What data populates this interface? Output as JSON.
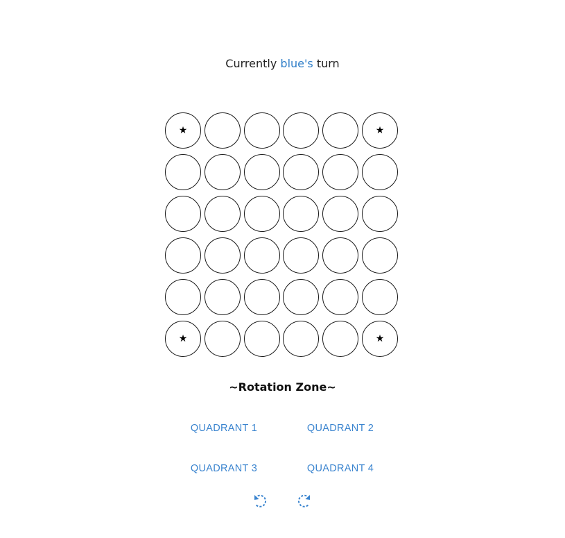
{
  "turn": {
    "prefix": "Currently",
    "player": "blue's",
    "suffix": "turn"
  },
  "board": {
    "rows": 6,
    "cols": 6,
    "stars": [
      [
        0,
        0
      ],
      [
        0,
        5
      ],
      [
        5,
        0
      ],
      [
        5,
        5
      ]
    ],
    "star_glyph": "★"
  },
  "rotation_zone": {
    "title": "~Rotation Zone~",
    "quadrants": [
      "QUADRANT 1",
      "QUADRANT 2",
      "QUADRANT 3",
      "QUADRANT 4"
    ],
    "rotate_left_icon": "rotate-counterclockwise-icon",
    "rotate_right_icon": "rotate-clockwise-icon"
  },
  "colors": {
    "accent": "#3a84cf",
    "player": "#2f7ec8"
  }
}
